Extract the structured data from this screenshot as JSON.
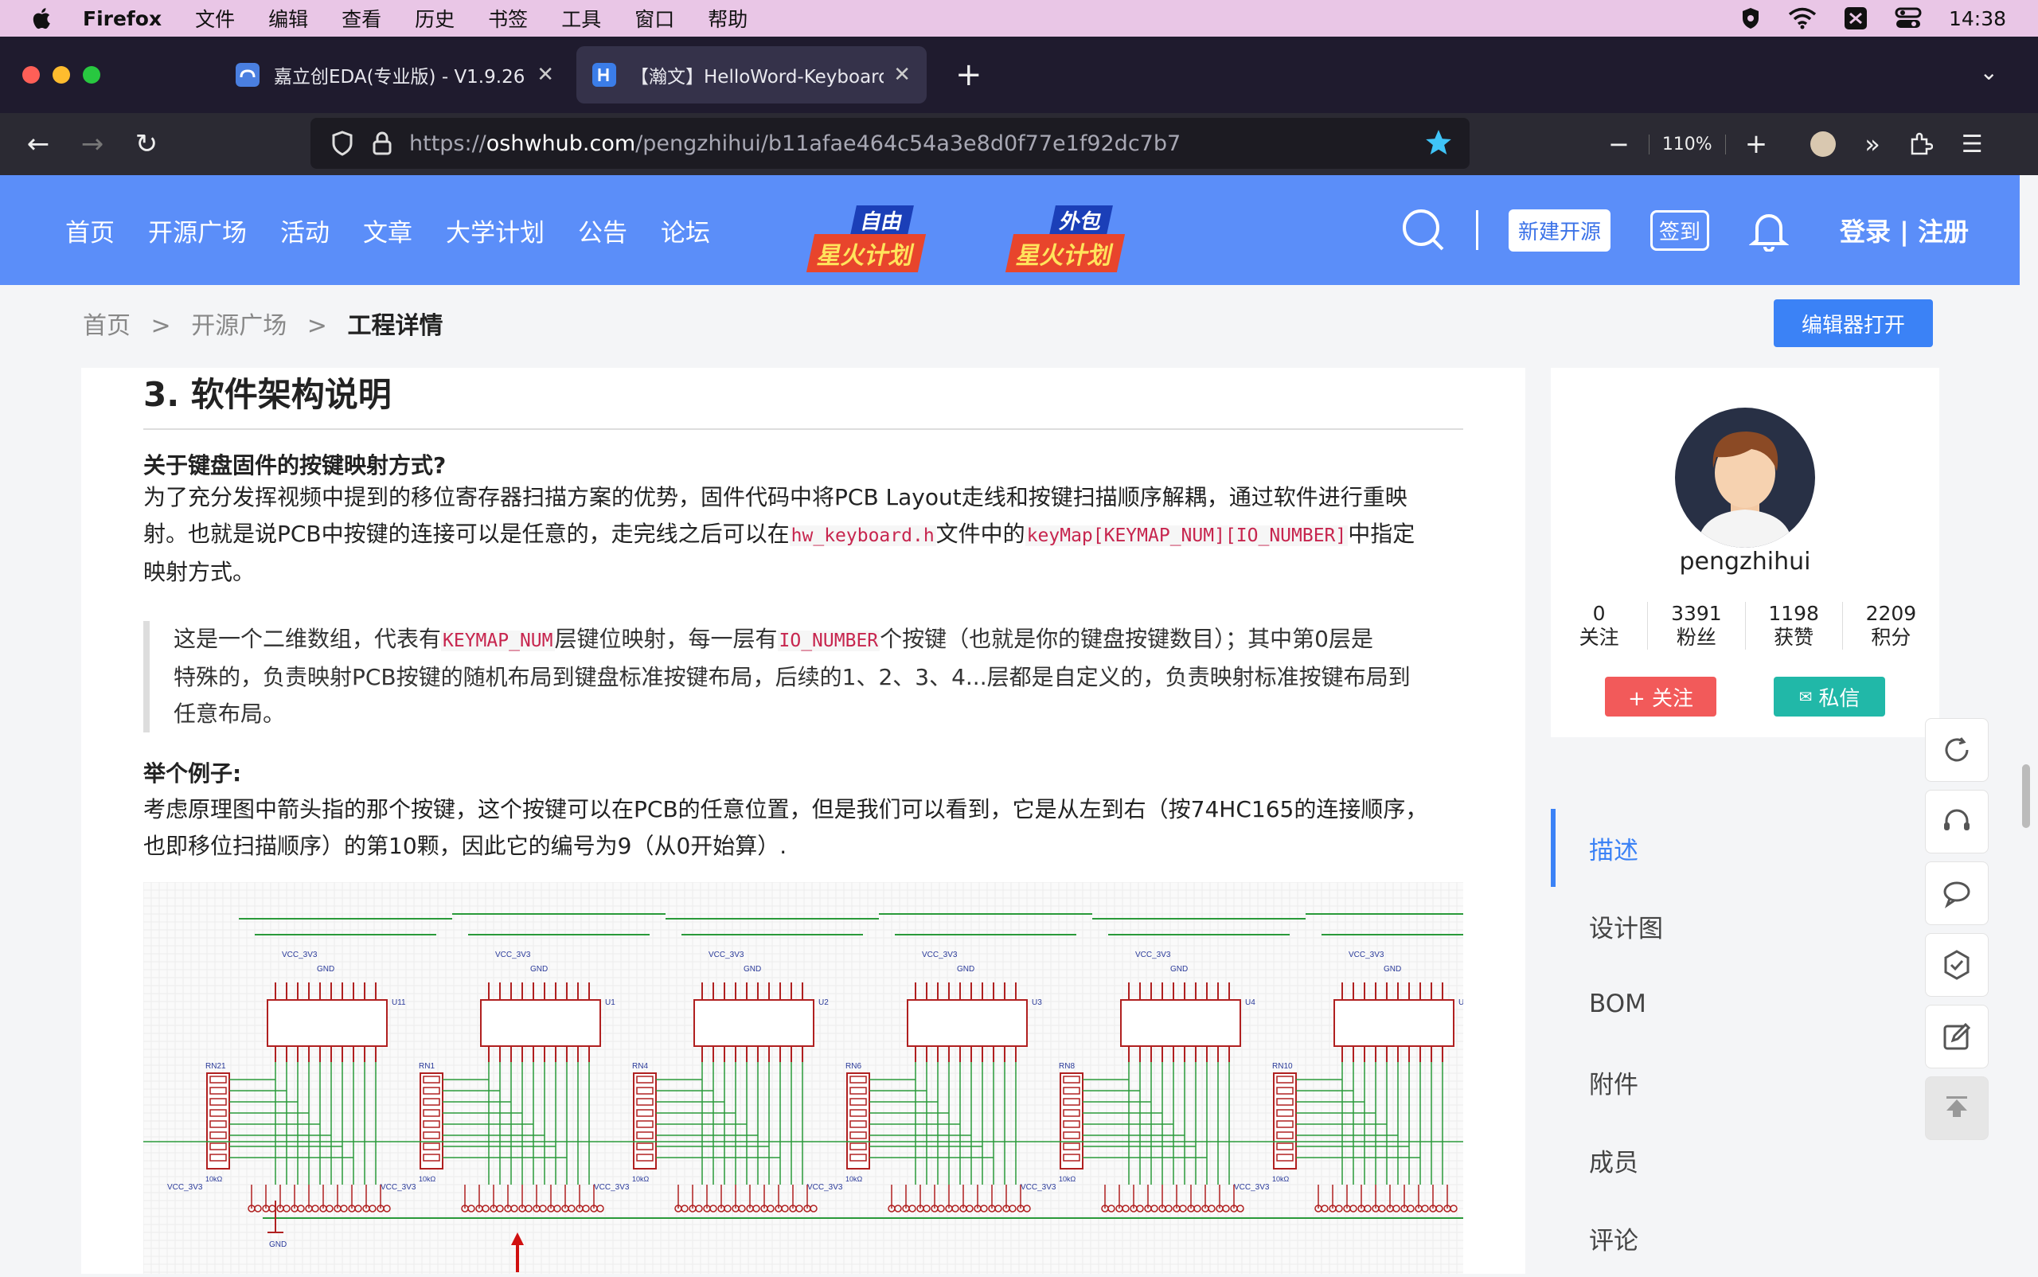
{
  "menubar": {
    "app": "Firefox",
    "items": [
      "文件",
      "编辑",
      "查看",
      "历史",
      "书签",
      "工具",
      "窗口",
      "帮助"
    ],
    "time": "14:38"
  },
  "tabs": [
    {
      "title": "嘉立创EDA(专业版) - V1.9.26"
    },
    {
      "title": "【瀚文】HelloWord-Keyboard - 立"
    }
  ],
  "url": {
    "prefix": "https://",
    "host": "oshwhub.com",
    "path": "/pengzhihui/b11afae464c54a3e8d0f77e1f92dc7b7"
  },
  "zoom": "110%",
  "site": {
    "nav": [
      "首页",
      "开源广场",
      "活动",
      "文章",
      "大学计划",
      "公告",
      "论坛"
    ],
    "badges": [
      {
        "top": "自由",
        "bottom": "星火计划"
      },
      {
        "top": "外包",
        "bottom": "星火计划"
      }
    ],
    "new_project": "新建开源",
    "signin": "签到",
    "login": "登录 | 注册"
  },
  "breadcrumb": {
    "home": "首页",
    "sep": ">",
    "square": "开源广场",
    "current": "工程详情"
  },
  "editor_open": "编辑器打开",
  "article": {
    "heading": "3. 软件架构说明",
    "q_title": "关于键盘固件的按键映射方式?",
    "p1a": "为了充分发挥视频中提到的移位寄存器扫描方案的优势，固件代码中将PCB Layout走线和按键扫描顺序解耦，通过软件进行重映",
    "p1b": "射。也就是说PCB中按键的连接可以是任意的，走完线之后可以在",
    "code1": "hw_keyboard.h",
    "p1c": "文件中的",
    "code2": "keyMap[KEYMAP_NUM][IO_NUMBER]",
    "p1d": "中指定",
    "p1e": "映射方式。",
    "q1": "这是一个二维数组，代表有",
    "qcode1": "KEYMAP_NUM",
    "q2": "层键位映射，每一层有",
    "qcode2": "IO_NUMBER",
    "q3": "个按键（也就是你的键盘按键数目）；其中第0层是",
    "q4": "特殊的，负责映射PCB按键的随机布局到键盘标准按键布局，后续的1、2、3、4...层都是自定义的，负责映射标准按键布局到",
    "q5": "任意布局。",
    "ex_title": "举个例子:",
    "p2a": "考虑原理图中箭头指的那个按键，这个按键可以在PCB的任意位置，但是我们可以看到，它是从左到右（按74HC165的连接顺序，",
    "p2b": "也即移位扫描顺序）的第10颗，因此它的编号为9（从0开始算）."
  },
  "schematic": {
    "chips": [
      "U11",
      "U1",
      "U2",
      "U3",
      "U4",
      "U"
    ],
    "vcc": "VCC_3V3",
    "gnd": "GND",
    "rn": [
      "RN21",
      "RN1",
      "RN4",
      "RN6",
      "RN8",
      "RN10"
    ],
    "res": "10kΩ"
  },
  "user": {
    "name": "pengzhihui",
    "stats": [
      {
        "n": "0",
        "l": "关注"
      },
      {
        "n": "3391",
        "l": "粉丝"
      },
      {
        "n": "1198",
        "l": "获赞"
      },
      {
        "n": "2209",
        "l": "积分"
      }
    ],
    "follow": "+ 关注",
    "message": "私信"
  },
  "sidenav": [
    "描述",
    "设计图",
    "BOM",
    "附件",
    "成员",
    "评论"
  ],
  "colors": {
    "site_blue": "#5b8ef9",
    "accent": "#3b82f6",
    "follow": "#f25a5a",
    "msg": "#21b8a8"
  }
}
